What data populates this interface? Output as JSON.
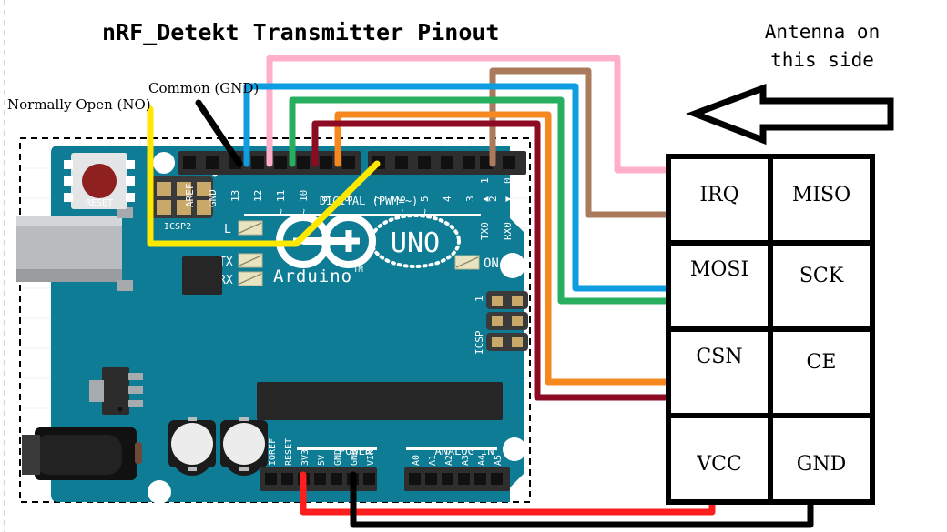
{
  "title": "nRF_Detekt Transmitter Pinout",
  "annotations": {
    "normally_open": "Normally Open (NO)",
    "common_gnd": "Common (GND)",
    "antenna_line1": "Antenna on",
    "antenna_line2": "this side",
    "arrow_icon": "left-arrow-icon"
  },
  "board": {
    "name": "Arduino",
    "trademark": "TM",
    "model": "UNO",
    "reset_label": "RESET",
    "icsp2_label": "ICSP2",
    "icsp_label": "ICSP",
    "icsp_pin1": "1",
    "led_l": "L",
    "led_tx": "TX",
    "led_rx": "RX",
    "led_on": "ON",
    "digital_label": "DIGITAL  (PWM=~)",
    "power_label": "POWER",
    "analog_label": "ANALOG IN",
    "digital_pins_left": [
      "AREF",
      "GND",
      "13",
      "12",
      "11",
      "10",
      "9",
      "8"
    ],
    "digital_pins_left_pwm": [
      "",
      "",
      "",
      "",
      "~",
      "~",
      "~",
      ""
    ],
    "digital_pins_right": [
      "7",
      "6",
      "5",
      "4",
      "3",
      "2",
      "1",
      "0"
    ],
    "digital_pins_right_pwm": [
      "",
      "~",
      "~",
      "",
      "~",
      "",
      "",
      ""
    ],
    "serial_tx": "TX0",
    "serial_rx": "RX0",
    "serial_tx_arrow": "▲",
    "serial_rx_arrow": "▼",
    "power_pins": [
      "IOREF",
      "RESET",
      "3V3",
      "5V",
      "GND",
      "GND",
      "VIN"
    ],
    "analog_pins": [
      "A0",
      "A1",
      "A2",
      "A3",
      "A4",
      "A5"
    ],
    "board_color": "#0E7C94",
    "board_color_dark": "#0B6A80",
    "silk_color": "#ffffff"
  },
  "pinout_table": {
    "rows": [
      {
        "left": "IRQ",
        "right": "MISO"
      },
      {
        "left": "MOSI",
        "right": "SCK"
      },
      {
        "left": "CSN",
        "right": "CE"
      },
      {
        "left": "VCC",
        "right": "GND"
      }
    ]
  },
  "wires": [
    {
      "name": "pink-wire",
      "color": "#FFAFC9",
      "from_pin": "12",
      "to_pin": "IRQ"
    },
    {
      "name": "brown-wire",
      "color": "#A97B5C",
      "from_pin": "2",
      "to_pin": "MISO"
    },
    {
      "name": "blue-wire",
      "color": "#0D9DE0",
      "from_pin": "13",
      "to_pin": "SCK"
    },
    {
      "name": "green-wire",
      "color": "#27AE5F",
      "from_pin": "11",
      "to_pin": "MOSI"
    },
    {
      "name": "orange-wire",
      "color": "#F7881F",
      "from_pin": "9",
      "to_pin": "CE"
    },
    {
      "name": "darkred-wire",
      "color": "#8C0A22",
      "from_pin": "10",
      "to_pin": "CSN"
    },
    {
      "name": "red-wire",
      "color": "#FF1E1E",
      "from_pin": "3V3",
      "to_pin": "VCC"
    },
    {
      "name": "black-wire",
      "color": "#000000",
      "from_pin": "GND",
      "to_pin": "GND"
    },
    {
      "name": "yellow-wire",
      "color": "#FFE800",
      "from_pin": "7",
      "to_pin": "Normally Open (NO)"
    },
    {
      "name": "black-switch-wire",
      "color": "#000000",
      "from_pin": "GND",
      "to_pin": "Common (GND)"
    }
  ]
}
